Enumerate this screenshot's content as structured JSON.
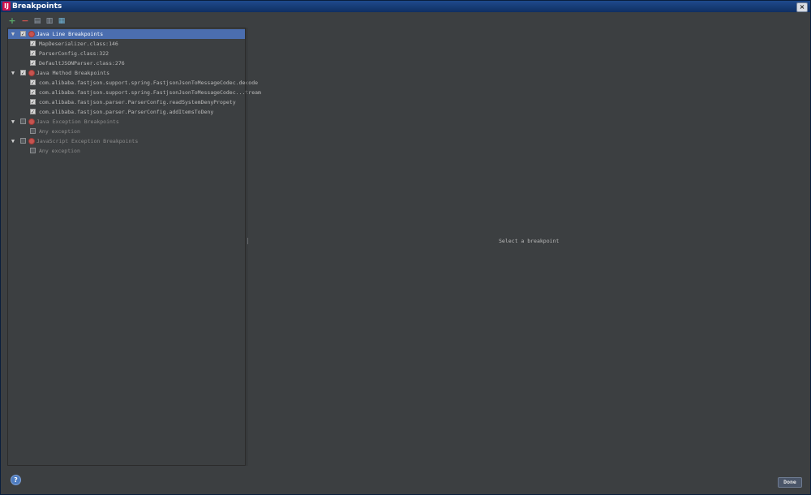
{
  "window": {
    "title": "Breakpoints",
    "app_icon": "ij-app-icon",
    "close_label": "×"
  },
  "toolbar": {
    "add": "+",
    "remove": "−",
    "group_by_package": "▤",
    "group_by_file": "▥",
    "flatten": "▦"
  },
  "colors": {
    "selection": "#4b6eaf",
    "breakpoint": "#c75450",
    "background": "#3c3f41"
  },
  "tree": [
    {
      "id": "g1",
      "label": "Java Line Breakpoints",
      "type": "group",
      "checked": true,
      "selected": true
    },
    {
      "id": "c1",
      "label": "MapDeserializer.class:146",
      "type": "item",
      "checked": true
    },
    {
      "id": "c2",
      "label": "ParserConfig.class:322",
      "type": "item",
      "checked": true
    },
    {
      "id": "c3",
      "label": "DefaultJSONParser.class:276",
      "type": "item",
      "checked": true
    },
    {
      "id": "g2",
      "label": "Java Method Breakpoints",
      "type": "group",
      "checked": true
    },
    {
      "id": "c4",
      "label": "com.alibaba.fastjson.support.spring.FastjsonJsonToMessageCodec.decode",
      "type": "item",
      "checked": true
    },
    {
      "id": "c5",
      "label": "com.alibaba.fastjson.support.spring.FastjsonJsonToMessageCodec...tream",
      "type": "item",
      "checked": true
    },
    {
      "id": "c6",
      "label": "com.alibaba.fastjson.parser.ParserConfig.readSystemDenyPropety",
      "type": "item",
      "checked": true
    },
    {
      "id": "c7",
      "label": "com.alibaba.fastjson.parser.ParserConfig.addItemsToDeny",
      "type": "item",
      "checked": true
    },
    {
      "id": "g3",
      "label": "Java Exception Breakpoints",
      "type": "group",
      "checked": false
    },
    {
      "id": "c8",
      "label": "Any exception",
      "type": "item",
      "checked": false
    },
    {
      "id": "g4",
      "label": "JavaScript Exception Breakpoints",
      "type": "group",
      "checked": false
    },
    {
      "id": "c9",
      "label": "Any exception",
      "type": "item",
      "checked": false
    }
  ],
  "details": {
    "empty_message": "Select a breakpoint"
  },
  "footer": {
    "help_label": "?",
    "done_label": "Done"
  }
}
